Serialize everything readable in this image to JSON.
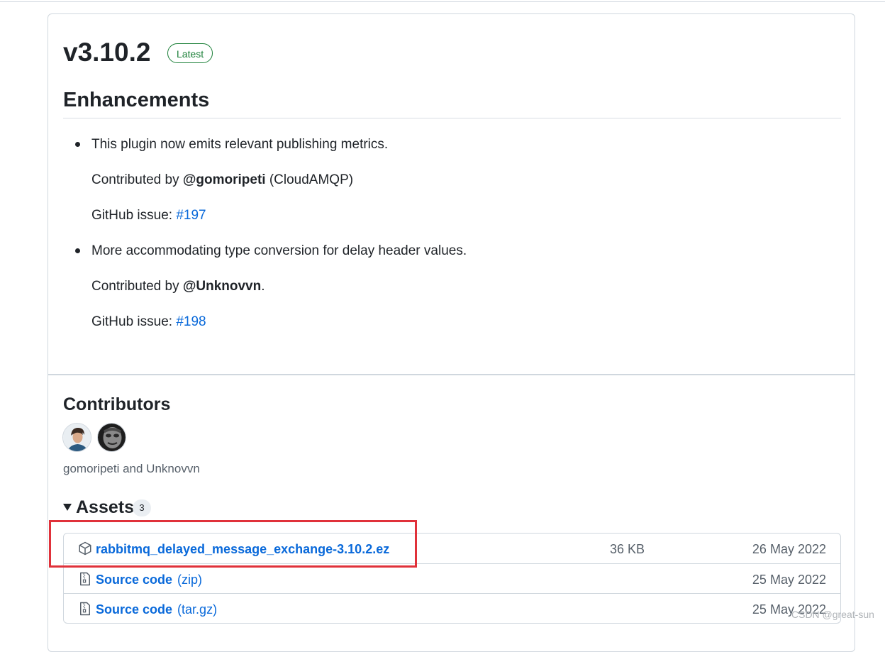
{
  "release": {
    "tag": "v3.10.2",
    "badge": "Latest",
    "section_heading": "Enhancements",
    "items": [
      {
        "text": "This plugin now emits relevant publishing metrics.",
        "contributed_prefix": "Contributed by ",
        "contributor": "@gomoripeti",
        "contributed_suffix": " (CloudAMQP)",
        "issue_prefix": "GitHub issue: ",
        "issue": "#197"
      },
      {
        "text": "More accommodating type conversion for delay header values.",
        "contributed_prefix": "Contributed by ",
        "contributor": "@Unknovvn",
        "contributed_suffix": ".",
        "issue_prefix": "GitHub issue: ",
        "issue": "#198"
      }
    ]
  },
  "contributors": {
    "title": "Contributors",
    "names": "gomoripeti and Unknovvn"
  },
  "assets": {
    "title": "Assets",
    "count": "3",
    "rows": [
      {
        "name": "rabbitmq_delayed_message_exchange-3.10.2.ez",
        "size": "36 KB",
        "date": "26 May 2022",
        "icon": "package-icon"
      },
      {
        "name": "Source code",
        "sub": "(zip)",
        "date": "25 May 2022",
        "icon": "file-zip-icon"
      },
      {
        "name": "Source code",
        "sub": "(tar.gz)",
        "date": "25 May 2022",
        "icon": "file-zip-icon"
      }
    ]
  },
  "watermark": "CSDN @great-sun",
  "colors": {
    "link": "#0969da",
    "latest_badge": "#1a7f37",
    "highlight": "#e0313a"
  }
}
